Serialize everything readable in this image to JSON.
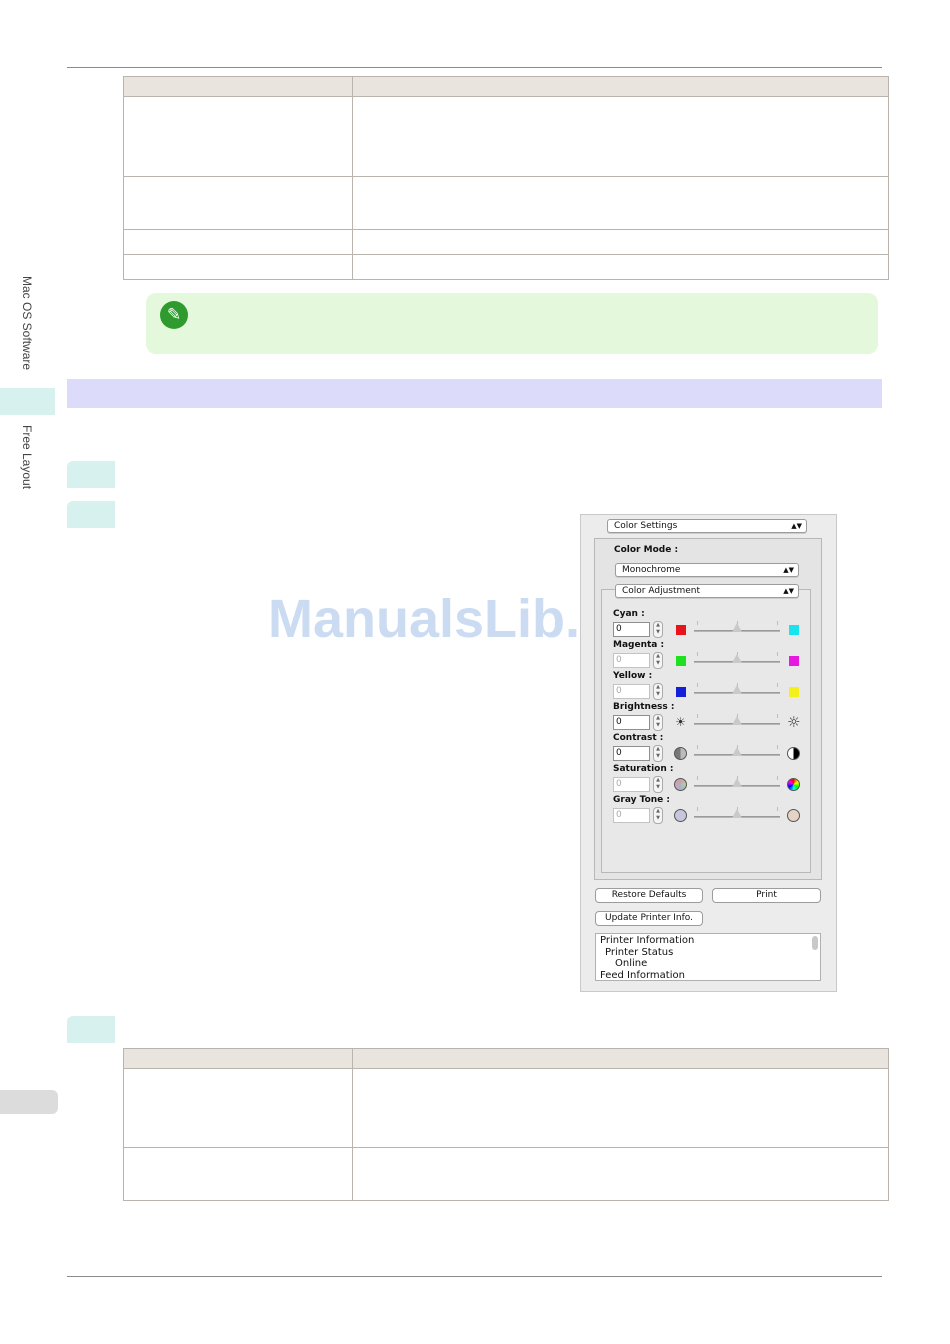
{
  "sidebar": {
    "section_label": "Mac OS Software",
    "sub_label": "Free Layout"
  },
  "watermark": "ManualsLib.com",
  "dialog": {
    "settings_popup": "Color Settings",
    "color_mode_label": "Color Mode :",
    "color_mode_value": "Monochrome",
    "adjustment_popup": "Color Adjustment",
    "sliders": [
      {
        "label": "Cyan :",
        "value": "0",
        "enabled": true,
        "left_color": "#e8141c",
        "right_color": "#19e3ef"
      },
      {
        "label": "Magenta :",
        "value": "0",
        "enabled": false,
        "left_color": "#1ee01e",
        "right_color": "#e619e0"
      },
      {
        "label": "Yellow :",
        "value": "0",
        "enabled": false,
        "left_color": "#1420d8",
        "right_color": "#f5ef1a"
      },
      {
        "label": "Brightness :",
        "value": "0",
        "enabled": true,
        "left_icon": "sun-dim-icon",
        "right_icon": "sun-bright-icon"
      },
      {
        "label": "Contrast :",
        "value": "0",
        "enabled": true,
        "left_icon": "low-contrast-icon",
        "right_icon": "high-contrast-icon"
      },
      {
        "label": "Saturation :",
        "value": "0",
        "enabled": false,
        "left_icon": "low-saturation-icon",
        "right_icon": "high-saturation-icon"
      },
      {
        "label": "Gray Tone :",
        "value": "0",
        "enabled": false,
        "left_icon": "cool-gray-icon",
        "right_icon": "warm-gray-icon"
      }
    ],
    "restore_defaults": "Restore Defaults",
    "print": "Print",
    "update_printer_info": "Update Printer Info.",
    "printer_info_lines": [
      "Printer Information",
      "Printer Status",
      "Online",
      "Feed Information"
    ]
  }
}
